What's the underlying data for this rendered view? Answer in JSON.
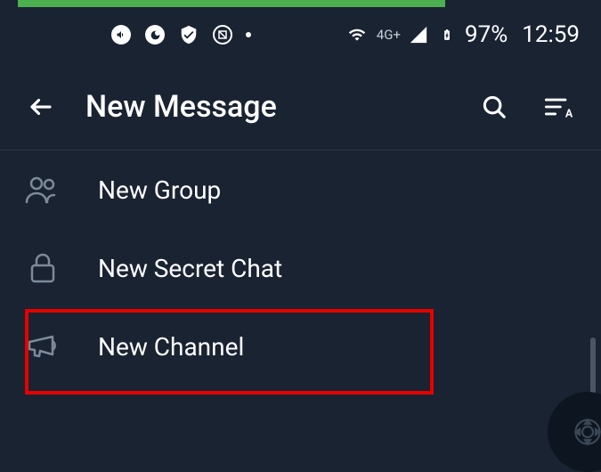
{
  "status": {
    "network": "4G+",
    "battery": "97%",
    "time": "12:59"
  },
  "header": {
    "title": "New Message"
  },
  "menu": {
    "items": [
      {
        "label": "New Group"
      },
      {
        "label": "New Secret Chat"
      },
      {
        "label": "New Channel"
      }
    ]
  }
}
